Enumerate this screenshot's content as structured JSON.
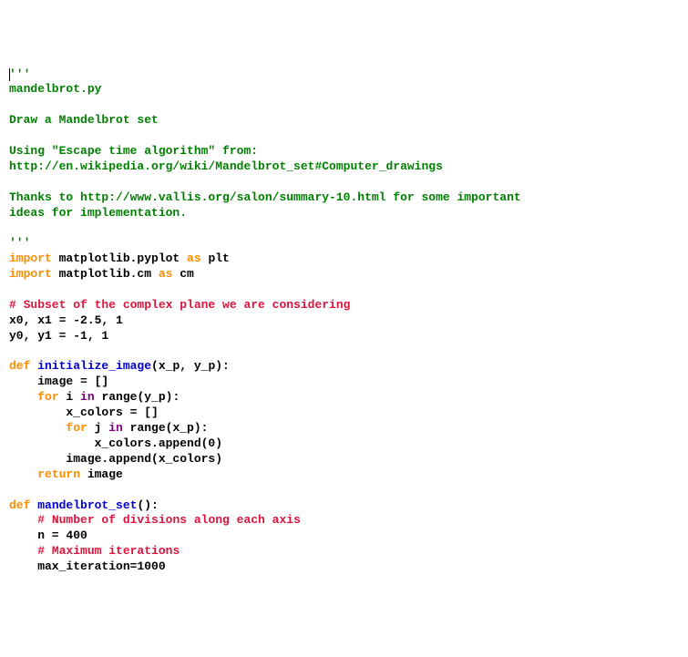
{
  "code": {
    "lines": [
      {
        "segments": [
          {
            "cls": "cursor",
            "text": ""
          },
          {
            "cls": "s",
            "text": "'''"
          }
        ]
      },
      {
        "segments": [
          {
            "cls": "s",
            "text": "mandelbrot.py"
          }
        ]
      },
      {
        "segments": [
          {
            "cls": "s",
            "text": ""
          }
        ]
      },
      {
        "segments": [
          {
            "cls": "s",
            "text": "Draw a Mandelbrot set"
          }
        ]
      },
      {
        "segments": [
          {
            "cls": "s",
            "text": ""
          }
        ]
      },
      {
        "segments": [
          {
            "cls": "s",
            "text": "Using \"Escape time algorithm\" from:"
          }
        ]
      },
      {
        "segments": [
          {
            "cls": "s",
            "text": "http://en.wikipedia.org/wiki/Mandelbrot_set#Computer_drawings"
          }
        ]
      },
      {
        "segments": [
          {
            "cls": "s",
            "text": ""
          }
        ]
      },
      {
        "segments": [
          {
            "cls": "s",
            "text": "Thanks to http://www.vallis.org/salon/summary-10.html for some important"
          }
        ]
      },
      {
        "segments": [
          {
            "cls": "s",
            "text": "ideas for implementation."
          }
        ]
      },
      {
        "segments": [
          {
            "cls": "s",
            "text": ""
          }
        ]
      },
      {
        "segments": [
          {
            "cls": "s",
            "text": "'''"
          }
        ]
      },
      {
        "segments": [
          {
            "cls": "k",
            "text": "import"
          },
          {
            "cls": "n",
            "text": " matplotlib.pyplot "
          },
          {
            "cls": "k",
            "text": "as"
          },
          {
            "cls": "n",
            "text": " plt"
          }
        ]
      },
      {
        "segments": [
          {
            "cls": "k",
            "text": "import"
          },
          {
            "cls": "n",
            "text": " matplotlib.cm "
          },
          {
            "cls": "k",
            "text": "as"
          },
          {
            "cls": "n",
            "text": " cm"
          }
        ]
      },
      {
        "segments": [
          {
            "cls": "n",
            "text": ""
          }
        ]
      },
      {
        "segments": [
          {
            "cls": "c",
            "text": "# Subset of the complex plane we are considering"
          }
        ]
      },
      {
        "segments": [
          {
            "cls": "n",
            "text": "x0, x1 = -2.5, 1"
          }
        ]
      },
      {
        "segments": [
          {
            "cls": "n",
            "text": "y0, y1 = -1, 1"
          }
        ]
      },
      {
        "segments": [
          {
            "cls": "n",
            "text": ""
          }
        ]
      },
      {
        "segments": [
          {
            "cls": "k",
            "text": "def"
          },
          {
            "cls": "n",
            "text": " "
          },
          {
            "cls": "nf",
            "text": "initialize_image"
          },
          {
            "cls": "n",
            "text": "(x_p, y_p):"
          }
        ]
      },
      {
        "segments": [
          {
            "cls": "n",
            "text": "    image = []"
          }
        ]
      },
      {
        "segments": [
          {
            "cls": "n",
            "text": "    "
          },
          {
            "cls": "k",
            "text": "for"
          },
          {
            "cls": "n",
            "text": " i "
          },
          {
            "cls": "kp",
            "text": "in"
          },
          {
            "cls": "n",
            "text": " range(y_p):"
          }
        ]
      },
      {
        "segments": [
          {
            "cls": "n",
            "text": "        x_colors = []"
          }
        ]
      },
      {
        "segments": [
          {
            "cls": "n",
            "text": "        "
          },
          {
            "cls": "k",
            "text": "for"
          },
          {
            "cls": "n",
            "text": " j "
          },
          {
            "cls": "kp",
            "text": "in"
          },
          {
            "cls": "n",
            "text": " range(x_p):"
          }
        ]
      },
      {
        "segments": [
          {
            "cls": "n",
            "text": "            x_colors.append(0)"
          }
        ]
      },
      {
        "segments": [
          {
            "cls": "n",
            "text": "        image.append(x_colors)"
          }
        ]
      },
      {
        "segments": [
          {
            "cls": "n",
            "text": "    "
          },
          {
            "cls": "k",
            "text": "return"
          },
          {
            "cls": "n",
            "text": " image"
          }
        ]
      },
      {
        "segments": [
          {
            "cls": "n",
            "text": ""
          }
        ]
      },
      {
        "segments": [
          {
            "cls": "k",
            "text": "def"
          },
          {
            "cls": "n",
            "text": " "
          },
          {
            "cls": "nf",
            "text": "mandelbrot_set"
          },
          {
            "cls": "n",
            "text": "():"
          }
        ]
      },
      {
        "segments": [
          {
            "cls": "n",
            "text": "    "
          },
          {
            "cls": "c",
            "text": "# Number of divisions along each axis"
          }
        ]
      },
      {
        "segments": [
          {
            "cls": "n",
            "text": "    n = 400"
          }
        ]
      },
      {
        "segments": [
          {
            "cls": "n",
            "text": "    "
          },
          {
            "cls": "c",
            "text": "# Maximum iterations"
          }
        ]
      },
      {
        "segments": [
          {
            "cls": "n",
            "text": "    max_iteration=1000"
          }
        ]
      }
    ]
  }
}
